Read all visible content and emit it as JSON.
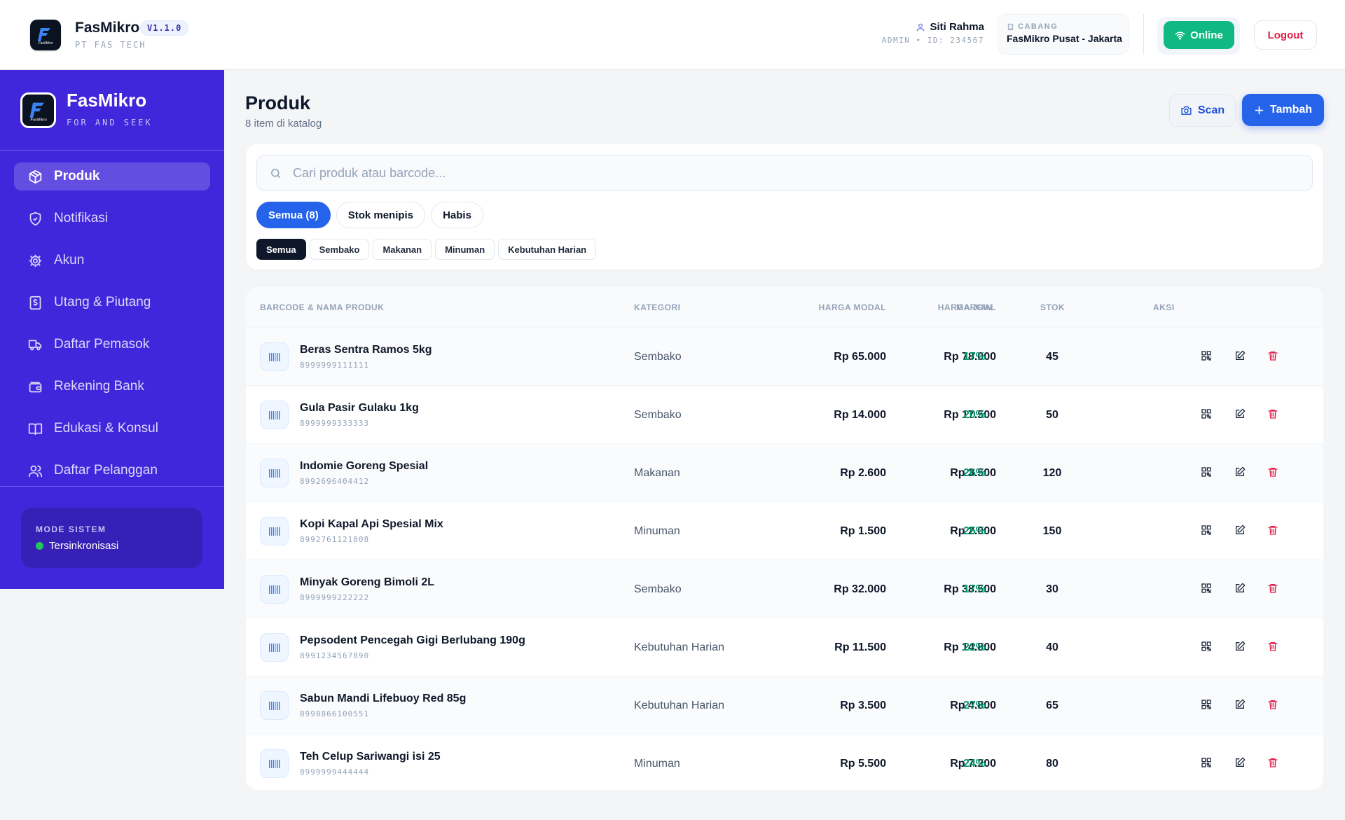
{
  "header": {
    "app_name": "FasMikro",
    "version": "V1.1.0",
    "company": "PT FAS TECH",
    "user_name": "Siti Rahma",
    "user_meta": "ADMIN • ID: 234567",
    "branch_label": "CABANG",
    "branch_value": "FasMikro Pusat - Jakarta",
    "online_label": "Online",
    "logout_label": "Logout",
    "logo_text": "FasMikro"
  },
  "sidebar": {
    "title": "FasMikro",
    "subtitle": "FOR AND SEEK",
    "items": [
      {
        "label": "Produk",
        "icon": "box-icon",
        "active": true
      },
      {
        "label": "Notifikasi",
        "icon": "shield-icon"
      },
      {
        "label": "Akun",
        "icon": "gear-icon"
      },
      {
        "label": "Utang & Piutang",
        "icon": "receipt-icon"
      },
      {
        "label": "Daftar Pemasok",
        "icon": "truck-icon"
      },
      {
        "label": "Rekening Bank",
        "icon": "wallet-icon"
      },
      {
        "label": "Edukasi & Konsul",
        "icon": "book-icon"
      },
      {
        "label": "Daftar Pelanggan",
        "icon": "users-icon"
      }
    ],
    "mode_label": "MODE SISTEM",
    "mode_status": "Tersinkronisasi"
  },
  "main": {
    "title": "Produk",
    "subtitle": "8 item di katalog",
    "scan_label": "Scan",
    "add_label": "Tambah",
    "search_placeholder": "Cari produk atau barcode...",
    "stock_tabs": [
      "Semua (8)",
      "Stok menipis",
      "Habis"
    ],
    "category_tabs": [
      "Semua",
      "Sembako",
      "Makanan",
      "Minuman",
      "Kebutuhan Harian"
    ]
  },
  "table": {
    "headers": {
      "product": "BARCODE & NAMA PRODUK",
      "category": "KATEGORI",
      "cost": "HARGA MODAL",
      "price": "HARGA JUAL",
      "margin": "MARGIN",
      "stock": "STOK",
      "actions": "AKSI"
    },
    "rows": [
      {
        "name": "Beras Sentra Ramos 5kg",
        "barcode": "8999999111111",
        "category": "Sembako",
        "cost": "Rp 65.000",
        "price": "Rp 78.000",
        "margin": "17%",
        "stock": "45"
      },
      {
        "name": "Gula Pasir Gulaku 1kg",
        "barcode": "8999999333333",
        "category": "Sembako",
        "cost": "Rp 14.000",
        "price": "Rp 17.500",
        "margin": "20%",
        "stock": "50"
      },
      {
        "name": "Indomie Goreng Spesial",
        "barcode": "8992696404412",
        "category": "Makanan",
        "cost": "Rp 2.600",
        "price": "Rp 3.500",
        "margin": "26%",
        "stock": "120"
      },
      {
        "name": "Kopi Kapal Api Spesial Mix",
        "barcode": "8992761121008",
        "category": "Minuman",
        "cost": "Rp 1.500",
        "price": "Rp 2.000",
        "margin": "25%",
        "stock": "150"
      },
      {
        "name": "Minyak Goreng Bimoli 2L",
        "barcode": "8999999222222",
        "category": "Sembako",
        "cost": "Rp 32.000",
        "price": "Rp 38.500",
        "margin": "17%",
        "stock": "30"
      },
      {
        "name": "Pepsodent Pencegah Gigi Berlubang 190g",
        "barcode": "8991234567890",
        "category": "Kebutuhan Harian",
        "cost": "Rp 11.500",
        "price": "Rp 14.800",
        "margin": "22%",
        "stock": "40"
      },
      {
        "name": "Sabun Mandi Lifebuoy Red 85g",
        "barcode": "8998866100551",
        "category": "Kebutuhan Harian",
        "cost": "Rp 3.500",
        "price": "Rp 4.800",
        "margin": "27%",
        "stock": "65"
      },
      {
        "name": "Teh Celup Sariwangi isi 25",
        "barcode": "8999999444444",
        "category": "Minuman",
        "cost": "Rp 5.500",
        "price": "Rp 7.200",
        "margin": "24%",
        "stock": "80"
      }
    ]
  },
  "colors": {
    "sidebar": "#4226db",
    "primary": "#2563eb",
    "online": "#10b981",
    "margin": "#059669",
    "danger": "#e11d48"
  }
}
